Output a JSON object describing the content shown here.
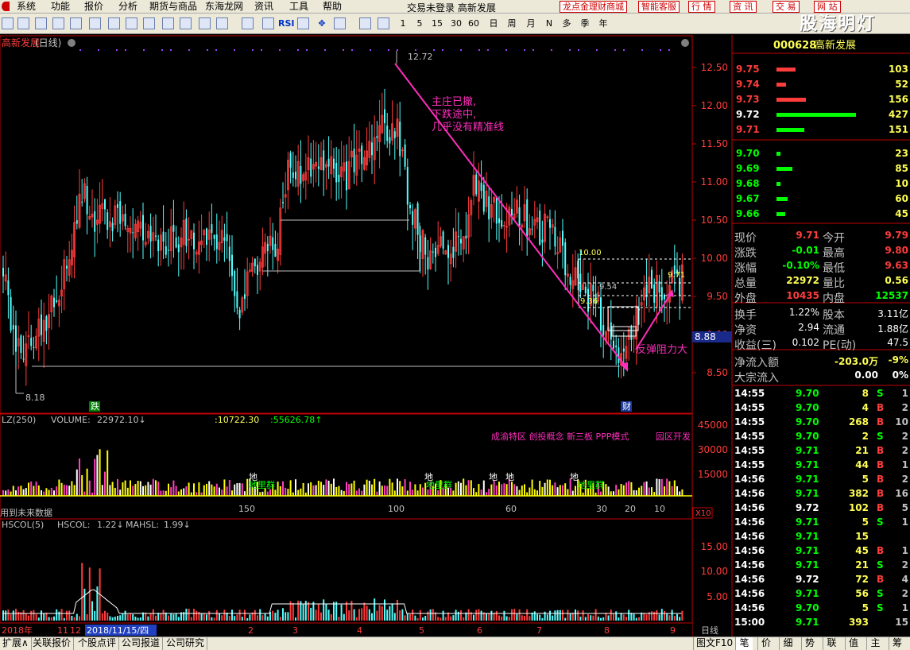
{
  "menu": {
    "items": [
      "系统",
      "功能",
      "报价",
      "分析",
      "期货与商品",
      "东海龙网",
      "资讯",
      "工具",
      "帮助"
    ],
    "status": "交易未登录 高新发展",
    "right_buttons": [
      "龙点金理财商城",
      "智能客服",
      "行 情",
      "资 讯",
      "交 易",
      "网 站"
    ]
  },
  "toolbar": {
    "periods": [
      "1",
      "5",
      "15",
      "30",
      "60",
      "日",
      "周",
      "月",
      "N",
      "多",
      "季",
      "年"
    ],
    "rsi": "RSI",
    "brand": "股海明灯"
  },
  "chart": {
    "title": "高新发展",
    "period": "(日线)",
    "prices_axis": [
      "12.50",
      "12.00",
      "11.50",
      "11.00",
      "10.50",
      "10.00",
      "9.50",
      "9.00",
      "8.50"
    ],
    "high_label": "12.72",
    "low_label": "8.18",
    "current_price_tag": "8.88",
    "level_10": "10.00",
    "level_954": "9.54",
    "level_936": "9.36",
    "level_971": "9.71",
    "badge_die": "跌",
    "badge_cai": "财",
    "annotation_top": [
      "主庄已撤,",
      "下跌途中,",
      "几乎没有精准线"
    ],
    "annotation_bottom": "反弹阻力大"
  },
  "volume": {
    "indicator": "LZ(250)",
    "vol_label": "VOLUME:",
    "vol_value": "22972.10↓",
    "v2": ":10722.30",
    "v3": ":55626.78↑",
    "concepts": "成渝特区 创投概念 新三板 PPP模式",
    "concept2": "园区开发",
    "axis": [
      "45000",
      "30000",
      "15000"
    ],
    "x_labels": [
      "150",
      "100",
      "60",
      "30",
      "20",
      "10"
    ],
    "x10": "X10",
    "note": "用到未来数据",
    "ground_marks": [
      "地",
      "地",
      "地",
      "地",
      "地"
    ],
    "ground_labels": [
      "地里群",
      "地里群",
      "地里群"
    ]
  },
  "hscol": {
    "label": "HSCOL(5)",
    "hscol_label": "HSCOL:",
    "hscol_value": "1.22↓",
    "mahsl_label": "MAHSL:",
    "mahsl_value": "1.99↓",
    "axis": [
      "15.00",
      "10.00",
      "5.00"
    ]
  },
  "dates": {
    "items": [
      "2018年",
      "11",
      "12",
      "2",
      "3",
      "4",
      "5",
      "6",
      "7",
      "8",
      "9"
    ],
    "highlight": "2018/11/15/四",
    "period": "日线"
  },
  "right_panel": {
    "code": "000628",
    "name": "高新发展",
    "asks": [
      {
        "p": "9.75",
        "v": "103"
      },
      {
        "p": "9.74",
        "v": "52"
      },
      {
        "p": "9.73",
        "v": "156"
      },
      {
        "p": "9.72",
        "v": "427"
      },
      {
        "p": "9.71",
        "v": "151"
      }
    ],
    "bids": [
      {
        "p": "9.70",
        "v": "23"
      },
      {
        "p": "9.69",
        "v": "85"
      },
      {
        "p": "9.68",
        "v": "10"
      },
      {
        "p": "9.67",
        "v": "60"
      },
      {
        "p": "9.66",
        "v": "45"
      }
    ],
    "quote": [
      [
        "现价",
        "9.71",
        "今开",
        "9.79"
      ],
      [
        "涨跌",
        "-0.01",
        "最高",
        "9.80"
      ],
      [
        "涨幅",
        "-0.10%",
        "最低",
        "9.63"
      ],
      [
        "总量",
        "22972",
        "量比",
        "0.56"
      ],
      [
        "外盘",
        "10435",
        "内盘",
        "12537"
      ]
    ],
    "stats": [
      [
        "换手",
        "1.22%",
        "股本",
        "3.11亿"
      ],
      [
        "净资",
        "2.94",
        "流通",
        "1.88亿"
      ],
      [
        "收益(三)",
        "0.102",
        "PE(动)",
        "47.5"
      ]
    ],
    "flow": [
      [
        "净流入额",
        "-203.0万",
        "-9%"
      ],
      [
        "大宗流入",
        "0.00",
        "0%"
      ]
    ],
    "ticks": [
      [
        "14:55",
        "9.70",
        "8",
        "S",
        "1"
      ],
      [
        "14:55",
        "9.70",
        "4",
        "B",
        "2"
      ],
      [
        "14:55",
        "9.70",
        "268",
        "B",
        "10"
      ],
      [
        "14:55",
        "9.70",
        "2",
        "S",
        "2"
      ],
      [
        "14:55",
        "9.71",
        "21",
        "B",
        "2"
      ],
      [
        "14:55",
        "9.71",
        "44",
        "B",
        "1"
      ],
      [
        "14:56",
        "9.71",
        "5",
        "B",
        "2"
      ],
      [
        "14:56",
        "9.71",
        "382",
        "B",
        "16"
      ],
      [
        "14:56",
        "9.72",
        "102",
        "B",
        "5"
      ],
      [
        "14:56",
        "9.71",
        "5",
        "S",
        "1"
      ],
      [
        "14:56",
        "9.71",
        "15",
        "",
        ""
      ],
      [
        "14:56",
        "9.71",
        "45",
        "B",
        "1"
      ],
      [
        "14:56",
        "9.71",
        "21",
        "S",
        "2"
      ],
      [
        "14:56",
        "9.72",
        "72",
        "B",
        "4"
      ],
      [
        "14:56",
        "9.71",
        "56",
        "S",
        "2"
      ],
      [
        "14:56",
        "9.70",
        "5",
        "S",
        "1"
      ],
      [
        "15:00",
        "9.71",
        "393",
        "",
        "15"
      ]
    ]
  },
  "bottom": {
    "tabs": [
      "扩展∧",
      "关联报价",
      "个股点评",
      "公司报道",
      "公司研究"
    ],
    "f10": "图文F10",
    "right_tabs": [
      "笔",
      "价",
      "细",
      "势",
      "联",
      "值",
      "主",
      "筹"
    ]
  },
  "colors": {
    "up": "#ff3c3c",
    "down": "#54ffff",
    "axis": "#c00000",
    "yellow": "#ffff54",
    "green": "#00ff00",
    "magenta": "#ff2ebc"
  }
}
